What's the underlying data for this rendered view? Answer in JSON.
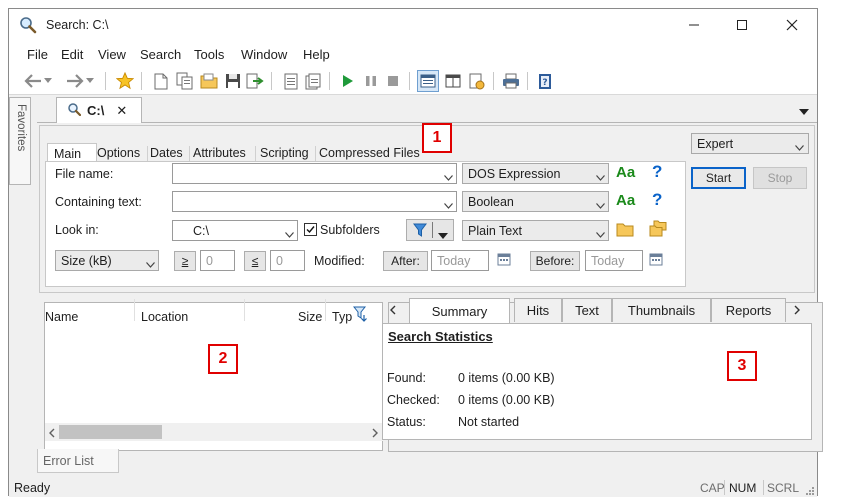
{
  "window": {
    "title": "Search: C:\\",
    "minimize": "—",
    "maximize": "☐",
    "close": "✕"
  },
  "menu": [
    "File",
    "Edit",
    "View",
    "Search",
    "Tools",
    "Window",
    "Help"
  ],
  "favorites_tab": "Favorites",
  "doc_tab": {
    "label": "C:\\",
    "close": "✕"
  },
  "criteria_tabs": [
    "Main",
    "Options",
    "Dates",
    "Attributes",
    "Scripting",
    "Compressed Files"
  ],
  "mode": {
    "value": "Expert"
  },
  "buttons": {
    "start": "Start",
    "stop": "Stop"
  },
  "file_name": {
    "label": "File name:",
    "value": "",
    "type": "DOS Expression"
  },
  "containing_text": {
    "label": "Containing text:",
    "value": "",
    "type": "Boolean"
  },
  "look_in": {
    "label": "Look in:",
    "value": "C:\\",
    "subfolders": "Subfolders",
    "subfolders_checked": true,
    "type": "Plain Text"
  },
  "case_label": "Aa",
  "help_label": "?",
  "size": {
    "unit": "Size (kB)",
    "ge": "≥",
    "ge_value": "0",
    "le": "≤",
    "le_value": "0"
  },
  "dates": {
    "modified_label": "Modified:",
    "after_label": "After:",
    "after_placeholder": "Today",
    "before_label": "Before:",
    "before_placeholder": "Today"
  },
  "results": {
    "columns": [
      "Name",
      "Location",
      "Size",
      "Typ"
    ]
  },
  "stats_tabs": [
    "Summary",
    "Hits",
    "Text",
    "Thumbnails",
    "Reports"
  ],
  "stats": {
    "heading": "Search Statistics",
    "rows": [
      {
        "label": "Found:",
        "value": "0 items (0.00 KB)"
      },
      {
        "label": "Checked:",
        "value": "0 items (0.00 KB)"
      },
      {
        "label": "Status:",
        "value": "Not started"
      }
    ]
  },
  "error_tab": "Error List",
  "status": {
    "text": "Ready",
    "cap": "CAP",
    "num": "NUM",
    "scrl": "SCRL"
  },
  "callouts": [
    "1",
    "2",
    "3"
  ],
  "colors": {
    "callout": "#e00000",
    "accent": "#0a63c9",
    "green": "#1b8a1b"
  }
}
